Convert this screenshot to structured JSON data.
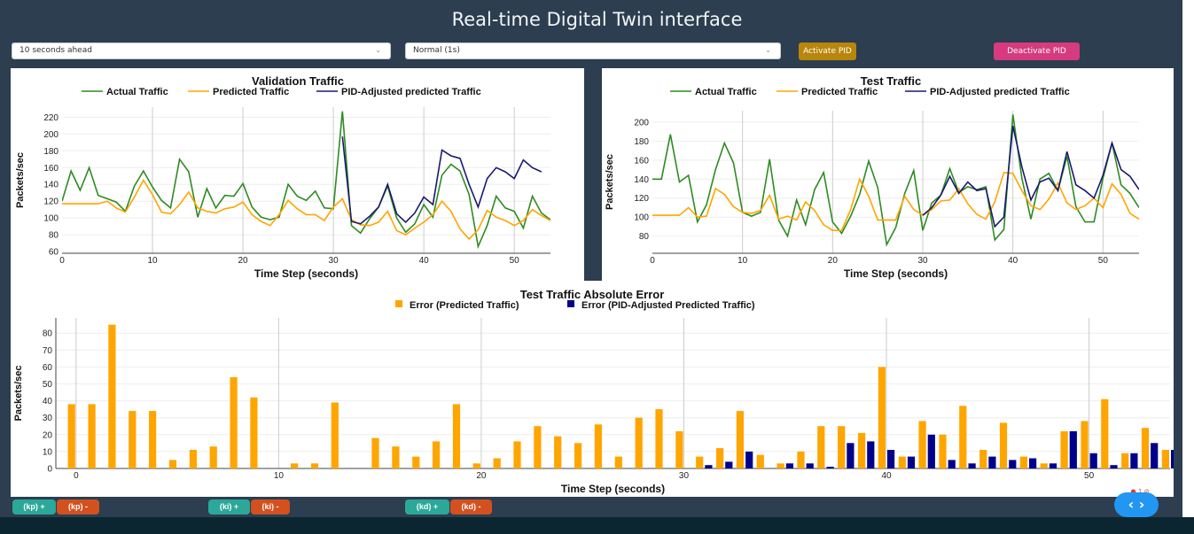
{
  "app": {
    "title": "Real-time Digital Twin interface"
  },
  "controls": {
    "horizon_value": "10 seconds ahead",
    "mode_value": "Normal (1s)",
    "activate_label": "Activate PID",
    "deactivate_label": "Deactivate PID"
  },
  "pid_buttons": {
    "kp_plus": "(kp) +",
    "kp_minus": "(kp) -",
    "ki_plus": "(ki) +",
    "ki_minus": "(ki) -",
    "kd_plus": "(kd) +",
    "kd_minus": "(kd) -"
  },
  "notification": {
    "count": "1"
  },
  "nav": {
    "icon": "chevron-left-right-icon"
  },
  "colors": {
    "actual": "#2e8b22",
    "predicted": "#ffa500",
    "pid_line": "#191970",
    "pid_bar": "#00008b",
    "activate": "#b8860b",
    "deactivate": "#d63a7f",
    "plus_button": "#2ba89a",
    "minus_button": "#d2511f"
  },
  "chart_data": [
    {
      "type": "line",
      "title": "Validation Traffic",
      "xlabel": "Time Step (seconds)",
      "ylabel": "Packets/sec",
      "xlim": [
        0,
        54
      ],
      "ylim": [
        58,
        232
      ],
      "xticks": [
        0,
        10,
        20,
        30,
        40,
        50
      ],
      "yticks": [
        60,
        80,
        100,
        120,
        140,
        160,
        180,
        200,
        220
      ],
      "grid": "vertical",
      "legend": "top",
      "series": [
        {
          "name": "Actual Traffic",
          "color_key": "actual",
          "x0": 0,
          "values": [
            120,
            156,
            133,
            160,
            127,
            123,
            119,
            108,
            138,
            156,
            137,
            121,
            112,
            170,
            155,
            101,
            135,
            112,
            127,
            126,
            141,
            113,
            101,
            98,
            101,
            140,
            126,
            121,
            132,
            112,
            111,
            227,
            91,
            82,
            99,
            113,
            138,
            100,
            83,
            93,
            116,
            101,
            151,
            164,
            156,
            128,
            66,
            91,
            126,
            112,
            108,
            88,
            126,
            106,
            98
          ]
        },
        {
          "name": "Predicted Traffic",
          "color_key": "predicted",
          "x0": 0,
          "values": [
            117,
            117,
            117,
            117,
            117,
            120,
            112,
            107,
            125,
            145,
            128,
            107,
            105,
            116,
            131,
            112,
            108,
            106,
            111,
            113,
            119,
            104,
            96,
            91,
            104,
            121,
            111,
            104,
            104,
            97,
            113,
            123,
            98,
            92,
            91,
            95,
            108,
            85,
            80,
            88,
            95,
            104,
            120,
            108,
            87,
            75,
            86,
            109,
            101,
            97,
            91,
            97,
            110,
            103,
            97
          ]
        },
        {
          "name": "PID-Adjusted predicted Traffic",
          "color_key": "pid_line",
          "x0": 31,
          "values": [
            197,
            96,
            93,
            102,
            113,
            140,
            105,
            95,
            106,
            125,
            116,
            181,
            174,
            171,
            140,
            113,
            147,
            160,
            155,
            147,
            169,
            160,
            155
          ]
        }
      ]
    },
    {
      "type": "line",
      "title": "Test Traffic",
      "xlabel": "Time Step (seconds)",
      "ylabel": "Packets/sec",
      "xlim": [
        0,
        54
      ],
      "ylim": [
        62,
        212
      ],
      "xticks": [
        0,
        10,
        20,
        30,
        40,
        50
      ],
      "yticks": [
        80,
        100,
        120,
        140,
        160,
        180,
        200
      ],
      "grid": "vertical",
      "legend": "top",
      "series": [
        {
          "name": "Actual Traffic",
          "color_key": "actual",
          "x0": 0,
          "values": [
            140,
            140,
            187,
            137,
            144,
            95,
            113,
            150,
            178,
            157,
            105,
            101,
            105,
            161,
            97,
            80,
            118,
            92,
            129,
            147,
            95,
            83,
            101,
            124,
            159,
            131,
            71,
            89,
            125,
            149,
            86,
            115,
            123,
            151,
            126,
            132,
            129,
            132,
            76,
            87,
            208,
            141,
            98,
            140,
            146,
            128,
            164,
            111,
            95,
            95,
            141,
            178,
            134,
            125,
            110
          ]
        },
        {
          "name": "Predicted Traffic",
          "color_key": "predicted",
          "x0": 0,
          "values": [
            102,
            102,
            102,
            102,
            110,
            100,
            101,
            130,
            124,
            111,
            105,
            104,
            107,
            123,
            98,
            101,
            97,
            116,
            107,
            92,
            86,
            86,
            108,
            140,
            122,
            97,
            97,
            97,
            122,
            108,
            102,
            108,
            117,
            118,
            130,
            114,
            103,
            98,
            116,
            147,
            146,
            128,
            112,
            108,
            119,
            136,
            115,
            108,
            112,
            120,
            110,
            135,
            124,
            104,
            98
          ]
        },
        {
          "name": "PID-Adjusted predicted Traffic",
          "color_key": "pid_line",
          "x0": 30,
          "values": [
            102,
            110,
            123,
            143,
            125,
            137,
            128,
            130,
            90,
            100,
            196,
            153,
            118,
            137,
            141,
            128,
            169,
            134,
            128,
            120,
            144,
            178,
            150,
            143,
            129
          ]
        }
      ]
    },
    {
      "type": "bar",
      "title": "Test Traffic Absolute Error",
      "xlabel": "Time Step (seconds)",
      "ylabel": "Packets/sec",
      "xlim": [
        -1,
        54
      ],
      "ylim": [
        0,
        89
      ],
      "xticks": [
        0,
        10,
        20,
        30,
        40,
        50
      ],
      "yticks": [
        0,
        10,
        20,
        30,
        40,
        50,
        60,
        70,
        80
      ],
      "grid": "vertical",
      "legend": "top",
      "x": [
        0,
        1,
        2,
        3,
        4,
        5,
        6,
        7,
        8,
        9,
        10,
        11,
        12,
        13,
        14,
        15,
        16,
        17,
        18,
        19,
        20,
        21,
        22,
        23,
        24,
        25,
        26,
        27,
        28,
        29,
        30,
        31,
        32,
        33,
        34,
        35,
        36,
        37,
        38,
        39,
        40,
        41,
        42,
        43,
        44,
        45,
        46,
        47,
        48,
        49,
        50,
        51,
        52,
        53,
        54
      ],
      "series": [
        {
          "name": "Error (Predicted Traffic)",
          "color_key": "predicted",
          "values": [
            38,
            38,
            85,
            34,
            34,
            5,
            11,
            13,
            54,
            42,
            0,
            3,
            3,
            39,
            0,
            18,
            13,
            7,
            16,
            38,
            3,
            6,
            16,
            25,
            19,
            15,
            26,
            7,
            30,
            35,
            22,
            7,
            12,
            34,
            8,
            3,
            10,
            25,
            25,
            21,
            60,
            7,
            28,
            20,
            37,
            11,
            27,
            7,
            3,
            22,
            28,
            41,
            9,
            24,
            11
          ]
        },
        {
          "name": "Error (PID-Adjusted Predicted Traffic)",
          "color_key": "pid_bar",
          "values": [
            0,
            0,
            0,
            0,
            0,
            0,
            0,
            0,
            0,
            0,
            0,
            0,
            0,
            0,
            0,
            0,
            0,
            0,
            0,
            0,
            0,
            0,
            0,
            0,
            0,
            0,
            0,
            0,
            0,
            0,
            0,
            2,
            4,
            10,
            0,
            3,
            3,
            1,
            15,
            16,
            11,
            7,
            20,
            5,
            3,
            7,
            5,
            6,
            3,
            22,
            9,
            2,
            9,
            15,
            11
          ]
        }
      ]
    }
  ]
}
